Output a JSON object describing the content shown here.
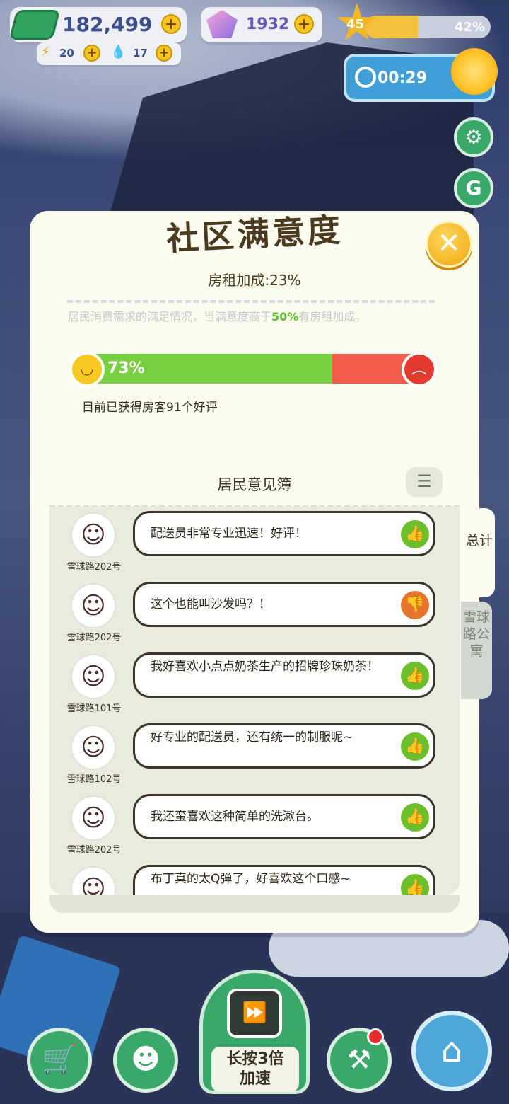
{
  "hud": {
    "cash": "182,499",
    "gems": "1932",
    "energy": "20",
    "water": "17",
    "level": "45",
    "xp_percent": "42%",
    "xp_fraction": 0.42,
    "timer": "00:29"
  },
  "icons": {
    "cash": "cash-icon",
    "gem": "gem-icon",
    "lightning": "lightning-icon",
    "water": "water-drop-icon",
    "star": "star-icon",
    "clock": "clock-icon",
    "sun": "sun-icon",
    "settings": "gear-icon",
    "g": "g-badge-icon",
    "close": "close-icon",
    "list": "list-icon",
    "thumb_up": "thumbs-up-icon",
    "thumb_down": "thumbs-down-icon",
    "cart": "shopping-cart-icon",
    "chat": "chat-face-icon",
    "tv": "tv-fast-forward-icon",
    "tools": "tools-icon",
    "home": "home-wrench-icon"
  },
  "panel": {
    "title": "社区满意度",
    "rent_bonus": "房租加成:23%",
    "description_pre": "居民消费需求的满足情况，当满意度高于",
    "description_highlight": "50%",
    "description_post": "有房租加成。",
    "satisfaction_percent": "73%",
    "satisfaction_fraction": 0.73,
    "reviews_text": "目前已获得房客91个好评",
    "book_title": "居民意见簿",
    "tab_total": "总计",
    "tab_apartment": "雪球路公寓"
  },
  "comments": [
    {
      "address": "雪球路202号",
      "text": "配送员非常专业迅速！好评！",
      "rating": "up"
    },
    {
      "address": "雪球路202号",
      "text": "这个也能叫沙发吗？！",
      "rating": "down"
    },
    {
      "address": "雪球路101号",
      "text": "我好喜欢小点点奶茶生产的招牌珍珠奶茶！",
      "rating": "up"
    },
    {
      "address": "雪球路102号",
      "text": "好专业的配送员，还有统一的制服呢~",
      "rating": "up"
    },
    {
      "address": "雪球路202号",
      "text": "我还蛮喜欢这种简单的洗漱台。",
      "rating": "up"
    },
    {
      "address": "",
      "text": "布丁真的太Q弹了，好喜欢这个口感~",
      "rating": "up"
    }
  ],
  "bottom": {
    "speed_label_1": "长按3倍",
    "speed_label_2": "加速"
  },
  "colors": {
    "panel_bg": "#fbfcef",
    "satisfied_green": "#78d041",
    "unsatisfied_red": "#f25c4a",
    "thumb_up": "#6bbf2b",
    "thumb_down": "#e7742c",
    "button_green": "#3aa86b"
  }
}
